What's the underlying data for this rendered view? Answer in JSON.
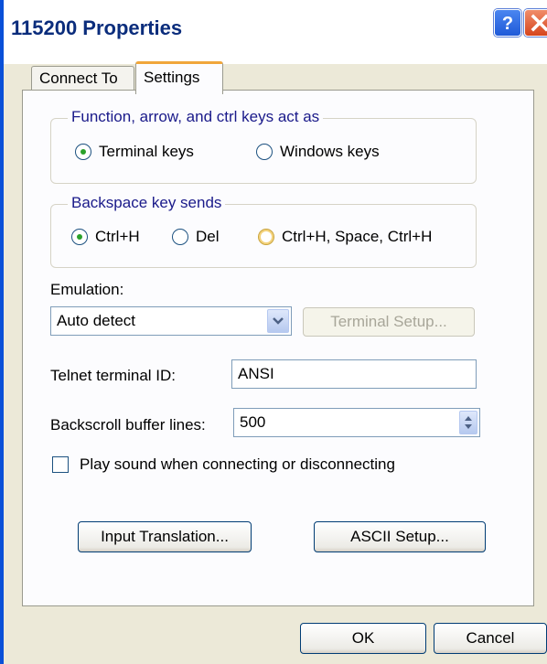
{
  "window": {
    "title": "115200 Properties",
    "accent": "#0a50d8",
    "icons": {
      "help": "help-icon",
      "close": "close-icon"
    }
  },
  "tabs": [
    {
      "label": "Connect To",
      "selected": false
    },
    {
      "label": "Settings",
      "selected": true
    }
  ],
  "function_keys": {
    "label": "Function, arrow, and ctrl keys act as",
    "options": [
      {
        "label": "Terminal keys",
        "checked": true
      },
      {
        "label": "Windows keys",
        "checked": false
      }
    ]
  },
  "backspace": {
    "label": "Backspace key sends",
    "options": [
      {
        "label": "Ctrl+H",
        "checked": true
      },
      {
        "label": "Del",
        "checked": false
      },
      {
        "label": "Ctrl+H, Space, Ctrl+H",
        "checked": false
      }
    ]
  },
  "emulation": {
    "label": "Emulation:",
    "value": "Auto detect",
    "terminal_setup_label": "Terminal Setup..."
  },
  "telnet": {
    "label": "Telnet terminal ID:",
    "value": "ANSI"
  },
  "backscroll": {
    "label": "Backscroll buffer lines:",
    "value": "500"
  },
  "play_sound": {
    "label": "Play sound when connecting or disconnecting",
    "checked": false
  },
  "buttons": {
    "input_translation": "Input Translation...",
    "ascii_setup": "ASCII Setup...",
    "ok": "OK",
    "cancel": "Cancel"
  }
}
